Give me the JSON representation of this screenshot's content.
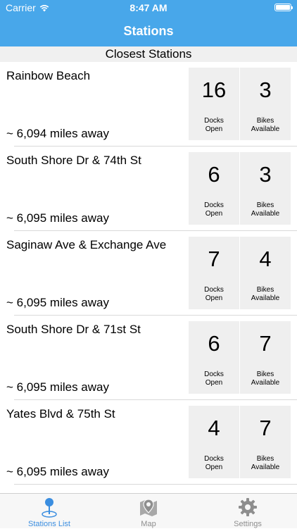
{
  "status_bar": {
    "carrier": "Carrier",
    "time": "8:47 AM"
  },
  "nav": {
    "title": "Stations"
  },
  "section": {
    "title": "Closest Stations"
  },
  "stations": [
    {
      "name": "Rainbow Beach",
      "distance": "~ 6,094 miles away",
      "docks": "16",
      "docks_label_1": "Docks",
      "docks_label_2": "Open",
      "bikes": "3",
      "bikes_label_1": "Bikes",
      "bikes_label_2": "Available"
    },
    {
      "name": "South Shore Dr & 74th St",
      "distance": "~ 6,095 miles away",
      "docks": "6",
      "docks_label_1": "Docks",
      "docks_label_2": "Open",
      "bikes": "3",
      "bikes_label_1": "Bikes",
      "bikes_label_2": "Available"
    },
    {
      "name": "Saginaw Ave & Exchange Ave",
      "distance": "~ 6,095 miles away",
      "docks": "7",
      "docks_label_1": "Docks",
      "docks_label_2": "Open",
      "bikes": "4",
      "bikes_label_1": "Bikes",
      "bikes_label_2": "Available"
    },
    {
      "name": "South Shore Dr & 71st St",
      "distance": "~ 6,095 miles away",
      "docks": "6",
      "docks_label_1": "Docks",
      "docks_label_2": "Open",
      "bikes": "7",
      "bikes_label_1": "Bikes",
      "bikes_label_2": "Available"
    },
    {
      "name": "Yates Blvd & 75th St",
      "distance": "~ 6,095 miles away",
      "docks": "4",
      "docks_label_1": "Docks",
      "docks_label_2": "Open",
      "bikes": "7",
      "bikes_label_1": "Bikes",
      "bikes_label_2": "Available"
    }
  ],
  "tabs": [
    {
      "label": "Stations List",
      "icon": "station-pin-icon",
      "active": true
    },
    {
      "label": "Map",
      "icon": "map-icon",
      "active": false
    },
    {
      "label": "Settings",
      "icon": "gear-icon",
      "active": false
    }
  ],
  "colors": {
    "accent": "#48a7ea",
    "tab_active": "#3b8ee0",
    "tab_inactive": "#8e8e8e"
  }
}
